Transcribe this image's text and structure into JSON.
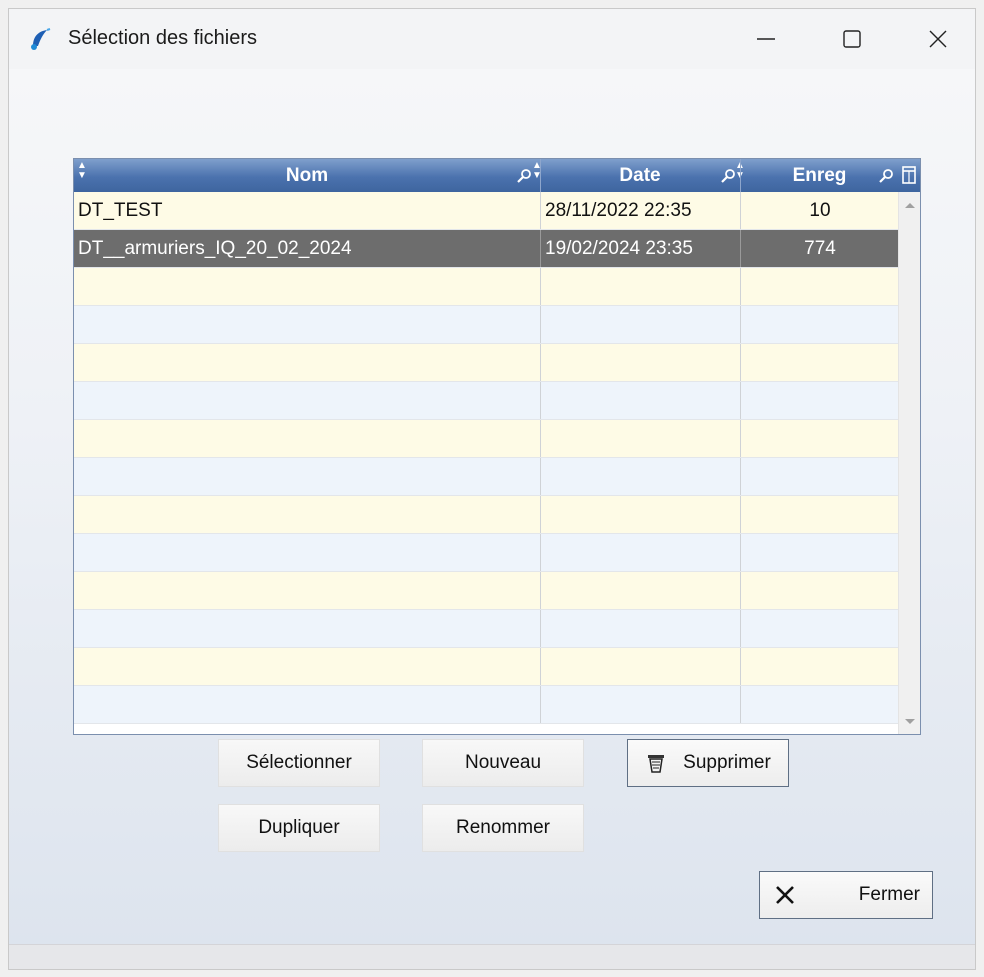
{
  "window": {
    "title": "Sélection des fichiers",
    "icon": "app-logo-icon",
    "controls": [
      "minimize-icon",
      "maximize-icon",
      "close-icon"
    ]
  },
  "grid": {
    "columns": [
      {
        "label": "Nom",
        "icons": [
          "sort-icon",
          "search-icon"
        ]
      },
      {
        "label": "Date",
        "icons": [
          "sort-icon",
          "search-icon"
        ]
      },
      {
        "label": "Enreg",
        "icons": [
          "sort-icon",
          "search-icon",
          "columns-icon"
        ]
      }
    ],
    "rows": [
      {
        "nom": "DT_TEST",
        "date": "28/11/2022  22:35",
        "enreg": "10",
        "selected": false
      },
      {
        "nom": "DT__armuriers_IQ_20_02_2024",
        "date": "19/02/2024  23:35",
        "enreg": "774",
        "selected": true
      }
    ],
    "empty_rows": 12,
    "colors": {
      "header": "#4b72ae",
      "row_odd": "#fefbe6",
      "row_even": "#eef4fb",
      "selected": "#6d6d6d"
    }
  },
  "buttons": {
    "select": "Sélectionner",
    "new": "Nouveau",
    "delete": "Supprimer",
    "duplicate": "Dupliquer",
    "rename": "Renommer",
    "close": "Fermer"
  }
}
